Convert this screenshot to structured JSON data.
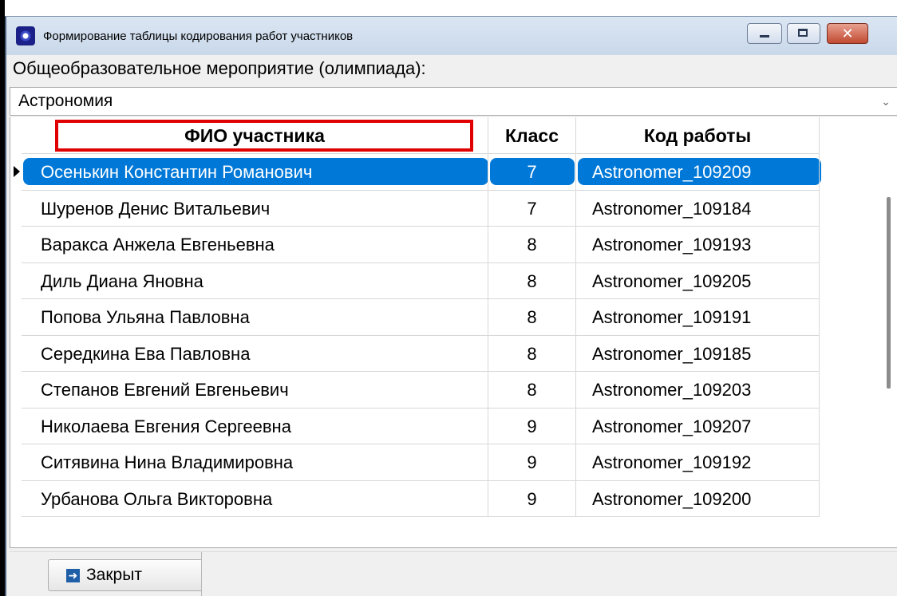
{
  "window": {
    "title": "Формирование таблицы кодирования работ участников",
    "close_glyph": "✕"
  },
  "olympiad": {
    "label": "Общеобразовательное мероприятие (олимпиада):",
    "selected_value": "Астрономия"
  },
  "table": {
    "columns": [
      "ФИО участника",
      "Класс",
      "Код работы"
    ],
    "rows": [
      {
        "fio": "Осенькин Константин Романович",
        "class": "7",
        "code": "Astronomer_109209"
      },
      {
        "fio": "Шуренов Денис Витальевич",
        "class": "7",
        "code": "Astronomer_109184"
      },
      {
        "fio": "Варакса Анжела Евгеньевна",
        "class": "8",
        "code": "Astronomer_109193"
      },
      {
        "fio": "Диль Диана Яновна",
        "class": "8",
        "code": "Astronomer_109205"
      },
      {
        "fio": "Попова Ульяна Павловна",
        "class": "8",
        "code": "Astronomer_109191"
      },
      {
        "fio": "Середкина Ева Павловна",
        "class": "8",
        "code": "Astronomer_109185"
      },
      {
        "fio": "Степанов Евгений Евгеньевич",
        "class": "8",
        "code": "Astronomer_109203"
      },
      {
        "fio": "Николаева Евгения Сергеевна",
        "class": "9",
        "code": "Astronomer_109207"
      },
      {
        "fio": "Ситявина Нина Владимировна",
        "class": "9",
        "code": "Astronomer_109192"
      },
      {
        "fio": "Урбанова Ольга Викторовна",
        "class": "9",
        "code": "Astronomer_109200"
      }
    ],
    "selected_row": 0
  },
  "footer": {
    "close_button_label": "Закрыт"
  },
  "colors": {
    "selection": "#0078d7",
    "highlight_border": "#e00000",
    "title_bar": "#cfdcec"
  }
}
